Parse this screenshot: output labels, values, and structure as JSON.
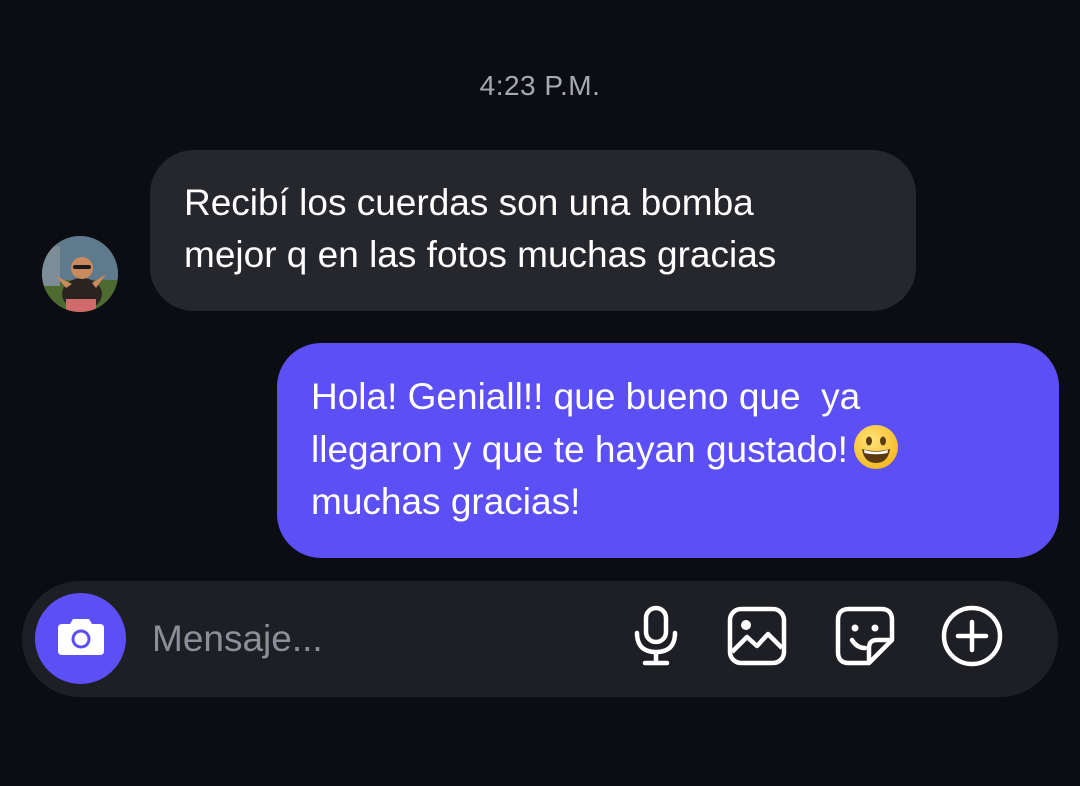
{
  "thread": {
    "timestamp": "4:23 P.M."
  },
  "messages": [
    {
      "direction": "incoming",
      "lines": [
        "Recibí los cuerdas son una bomba",
        "mejor q en las fotos muchas gracias"
      ]
    },
    {
      "direction": "outgoing",
      "lines": [
        "Hola! Geniall!! que bueno que  ya",
        "llegaron y que te hayan gustado!",
        "muchas gracias!"
      ],
      "emoji": "grinning-face"
    }
  ],
  "composer": {
    "placeholder": "Mensaje...",
    "icons": [
      "camera-icon",
      "microphone-icon",
      "image-icon",
      "sticker-icon",
      "plus-circle-icon"
    ]
  },
  "colors": {
    "background": "#0b0d12",
    "incoming_bubble": "#26272c",
    "outgoing_bubble": "#5b4ff5",
    "composer": "#1e1f24",
    "accent": "#5b4ff5"
  }
}
